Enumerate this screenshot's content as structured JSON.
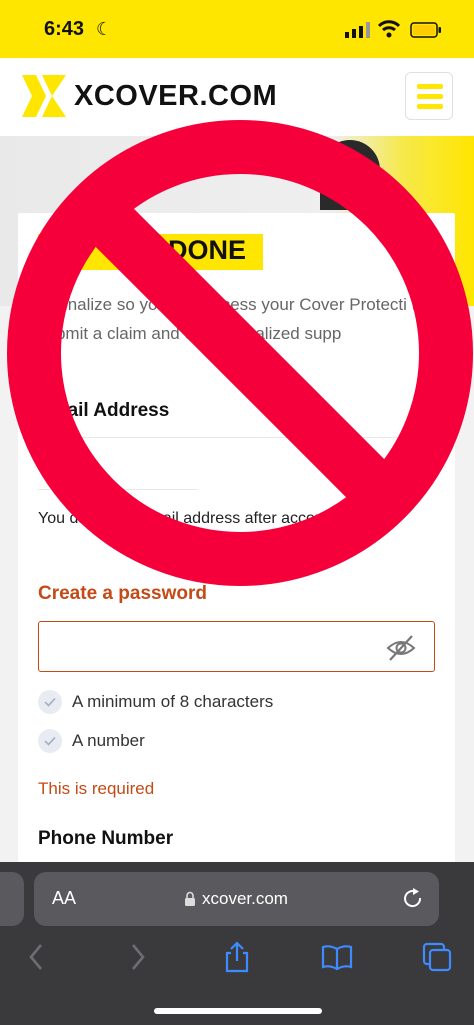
{
  "status_bar": {
    "time": "6:43"
  },
  "header": {
    "logo_text": "XCOVER.COM"
  },
  "form": {
    "heading": "DONE",
    "intro": "t's finalize so you can access your Cover Protecti ts, submit a claim and et personalized supp",
    "email_label": "Email Address",
    "email_note": "You date your email address after account",
    "password_label": "Create a password",
    "requirements": [
      "A minimum of 8 characters",
      "A number"
    ],
    "error_text": "This is required",
    "phone_label": "Phone Number"
  },
  "browser": {
    "aa_label": "AA",
    "url": "xcover.com"
  },
  "colors": {
    "brand_yellow": "#ffe600",
    "error_orange": "#c44a16",
    "prohibition_red": "#f5003a"
  }
}
